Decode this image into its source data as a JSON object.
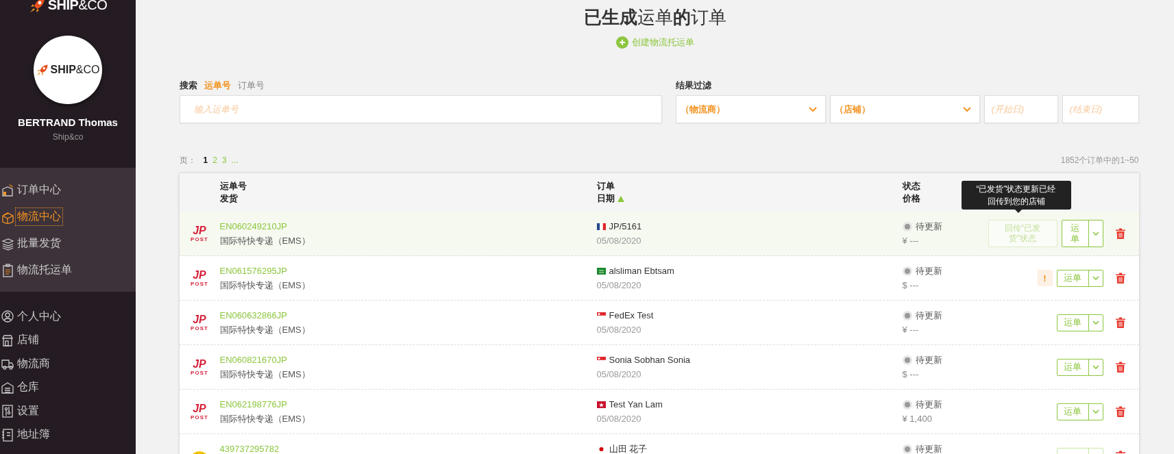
{
  "sidebar": {
    "logo": "**SHIP**&CO",
    "avatar_logo": "**SHIP**&CO",
    "user_name": "BERTRAND Thomas",
    "company": "Ship&co",
    "nav_groups": [
      {
        "highlighted": true,
        "items": [
          {
            "label": "订单中心",
            "selected": false
          },
          {
            "label": "物流中心",
            "selected": true
          },
          {
            "label": "批量发货",
            "selected": false
          },
          {
            "label": "物流托运单",
            "selected": false
          }
        ]
      },
      {
        "highlighted": false,
        "items": [
          {
            "label": "个人中心",
            "selected": false
          },
          {
            "label": "店铺",
            "selected": false
          },
          {
            "label": "物流商",
            "selected": false
          },
          {
            "label": "仓库",
            "selected": false
          },
          {
            "label": "设置",
            "selected": false
          },
          {
            "label": "地址簿",
            "selected": false
          }
        ]
      }
    ]
  },
  "header": {
    "title": "**已生成**运单**的**订单",
    "create_link": "创建物流托运单"
  },
  "search": {
    "label": "搜索",
    "modes": [
      {
        "label": "运单号",
        "selected": true
      },
      {
        "label": "订单号",
        "selected": false
      }
    ],
    "placeholder": "输入运单号"
  },
  "filter": {
    "label": "结果过滤",
    "selects": [
      {
        "value": "（物流商）"
      },
      {
        "value": "（店铺）"
      }
    ],
    "dates": [
      {
        "placeholder": "(开始日)"
      },
      {
        "placeholder": "(结束日)"
      }
    ]
  },
  "pagination": {
    "label": "页：",
    "pages": [
      {
        "label": "1",
        "selected": true
      },
      {
        "label": "2",
        "selected": false
      },
      {
        "label": "3",
        "selected": false
      }
    ],
    "more": "...",
    "summary": "1852个订单中的1~50"
  },
  "table": {
    "columns": [
      {
        "lines": [
          "运单号",
          "发货"
        ],
        "sorted": false
      },
      {
        "lines": [
          "订单",
          "日期"
        ],
        "sorted": true
      },
      {
        "lines": [
          "状态",
          "价格"
        ],
        "sorted": false
      }
    ],
    "tooltip": [
      "“已发货”状态更新已经",
      "回传到您的店铺"
    ],
    "rows": [
      {
        "carrier": {
          "kind": "jp-post",
          "logo": "JP",
          "logo_sub": "POST"
        },
        "tracking": "EN060249210JP",
        "service": "国际特快专递（EMS）",
        "flag": {
          "kind": "fr"
        },
        "order": "JP/5161",
        "date": "05/08/2020",
        "status": "待更新",
        "price": "¥ ---",
        "highlighted": true,
        "sync_button": {
          "label": "回传“已发货”状态",
          "disabled": true
        },
        "shipment_button": {
          "label": "运单",
          "disabled": false
        }
      },
      {
        "carrier": {
          "kind": "jp-post",
          "logo": "JP",
          "logo_sub": "POST"
        },
        "tracking": "EN061576295JP",
        "service": "国际特快专递（EMS）",
        "flag": {
          "kind": "sa"
        },
        "order": "alsliman Ebtsam",
        "date": "05/08/2020",
        "status": "待更新",
        "price": "$ ---",
        "highlighted": false,
        "warning": "!",
        "shipment_button": {
          "label": "运单",
          "disabled": false
        }
      },
      {
        "carrier": {
          "kind": "jp-post",
          "logo": "JP",
          "logo_sub": "POST"
        },
        "tracking": "EN060632866JP",
        "service": "国际特快专递（EMS）",
        "flag": {
          "kind": "sg"
        },
        "order": "FedEx Test",
        "date": "05/08/2020",
        "status": "待更新",
        "price": "¥ ---",
        "highlighted": false,
        "shipment_button": {
          "label": "运单",
          "disabled": false
        }
      },
      {
        "carrier": {
          "kind": "jp-post",
          "logo": "JP",
          "logo_sub": "POST"
        },
        "tracking": "EN060821670JP",
        "service": "国际特快专递（EMS）",
        "flag": {
          "kind": "sg"
        },
        "order": "Sonia Sobhan Sonia",
        "date": "05/08/2020",
        "status": "待更新",
        "price": "$ ---",
        "highlighted": false,
        "shipment_button": {
          "label": "运单",
          "disabled": false
        }
      },
      {
        "carrier": {
          "kind": "jp-post",
          "logo": "JP",
          "logo_sub": "POST"
        },
        "tracking": "EN062198776JP",
        "service": "国际特快专递（EMS）",
        "flag": {
          "kind": "hk"
        },
        "order": "Test Yan Lam",
        "date": "05/08/2020",
        "status": "待更新",
        "price": "¥ 1,400",
        "highlighted": false,
        "shipment_button": {
          "label": "运单",
          "disabled": false
        }
      },
      {
        "carrier": {
          "kind": "yamato"
        },
        "tracking": "439737295782",
        "flag": {
          "kind": "jp"
        },
        "order": "山田 花子",
        "status": "待更新",
        "highlighted": false,
        "shipment_button": {
          "disabled": true
        }
      }
    ]
  }
}
